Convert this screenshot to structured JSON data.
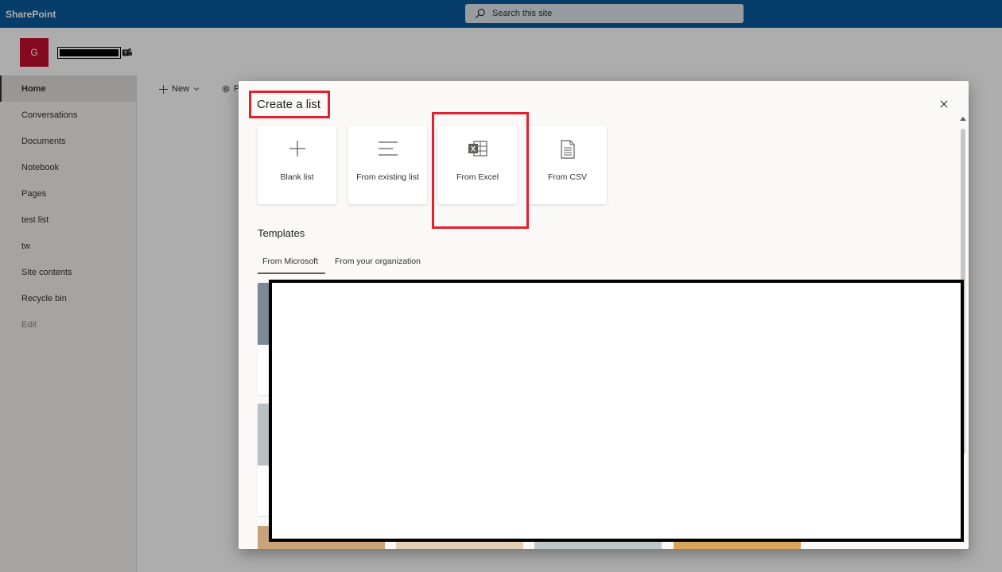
{
  "suitebar": {
    "brand": "SharePoint",
    "search_placeholder": "Search this site",
    "color": "#0b5a9c"
  },
  "site": {
    "logo_letter": "G",
    "logo_color": "#c4102e",
    "teams_icon": "teams-icon"
  },
  "leftnav": {
    "items": [
      {
        "label": "Home",
        "active": true
      },
      {
        "label": "Conversations"
      },
      {
        "label": "Documents"
      },
      {
        "label": "Notebook"
      },
      {
        "label": "Pages"
      },
      {
        "label": "test list"
      },
      {
        "label": "tw"
      },
      {
        "label": "Site contents"
      },
      {
        "label": "Recycle bin"
      },
      {
        "label": "Edit"
      }
    ]
  },
  "cmdbar": {
    "new_label": "New",
    "settings_label": "P"
  },
  "panel": {
    "title": "Create a list",
    "close_icon": "close-icon",
    "cards": [
      {
        "label": "Blank list",
        "icon": "plus-icon"
      },
      {
        "label": "From existing list",
        "icon": "list-lines-icon"
      },
      {
        "label": "From Excel",
        "icon": "excel-icon"
      },
      {
        "label": "From CSV",
        "icon": "csv-file-icon"
      }
    ],
    "templates_heading": "Templates",
    "tabs": [
      {
        "label": "From Microsoft",
        "active": true
      },
      {
        "label": "From your organization"
      }
    ]
  },
  "highlight_color": "#e3202b"
}
